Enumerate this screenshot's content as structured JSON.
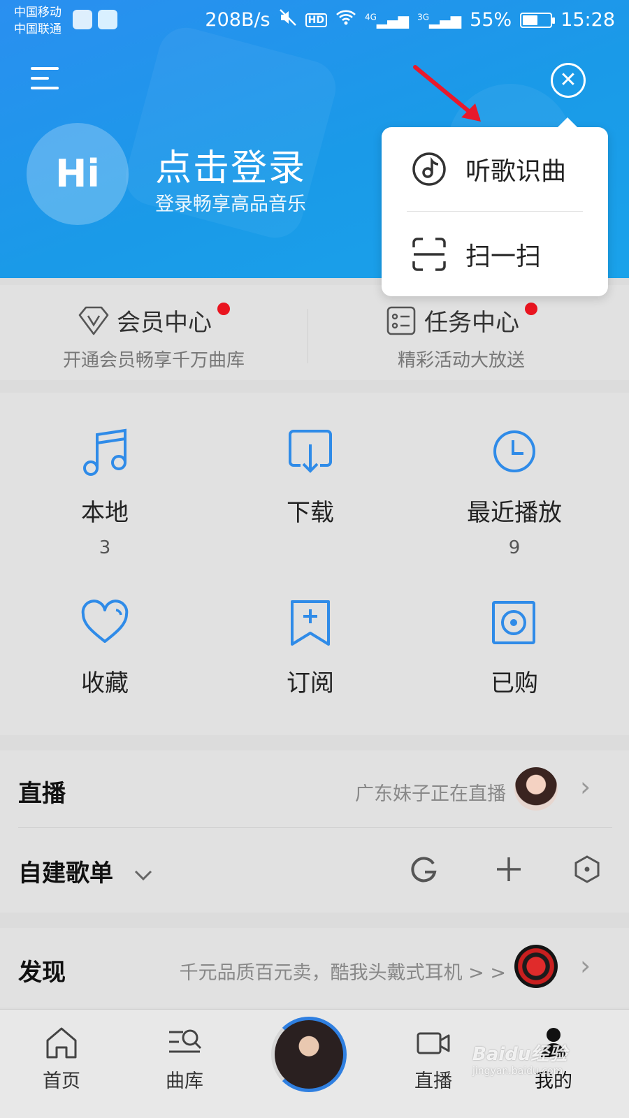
{
  "status_bar": {
    "carrier1": "中国移动",
    "carrier2": "中国联通",
    "speed": "208B/s",
    "hd": "HD",
    "net4g": "4G",
    "net3g": "3G",
    "battery": "55%",
    "battery_level": 0.55,
    "time": "15:28"
  },
  "header": {
    "avatar_text": "Hi",
    "login_title": "点击登录",
    "login_subtitle": "登录畅享高品音乐"
  },
  "popup_menu": {
    "items": [
      {
        "label": "听歌识曲",
        "icon": "music-recognize-icon"
      },
      {
        "label": "扫一扫",
        "icon": "scan-icon"
      }
    ]
  },
  "vip_row": {
    "vip": {
      "title": "会员中心",
      "subtitle": "开通会员畅享千万曲库"
    },
    "task": {
      "title": "任务中心",
      "subtitle": "精彩活动大放送"
    }
  },
  "grid": {
    "items": [
      {
        "label": "本地",
        "count": "3",
        "icon": "music-note-icon"
      },
      {
        "label": "下载",
        "count": "",
        "icon": "download-icon"
      },
      {
        "label": "最近播放",
        "count": "9",
        "icon": "clock-icon"
      },
      {
        "label": "收藏",
        "count": "",
        "icon": "heart-icon"
      },
      {
        "label": "订阅",
        "count": "",
        "icon": "subscribe-icon"
      },
      {
        "label": "已购",
        "count": "",
        "icon": "purchased-icon"
      }
    ]
  },
  "live": {
    "title": "直播",
    "note": "广东妹子正在直播"
  },
  "playlist": {
    "title": "自建歌单"
  },
  "discover": {
    "title": "发现",
    "note": "千元品质百元卖，酷我头戴式耳机 > >"
  },
  "bottom_nav": {
    "home": "首页",
    "library": "曲库",
    "live": "直播",
    "mine": "我的"
  },
  "watermark": {
    "text": "Baidu经验",
    "url": "jingyan.baidu.com"
  },
  "colors": {
    "header_blue": "#1a9ae8",
    "icon_blue": "#2f8be8",
    "red_dot": "#e9141f",
    "arrow_red": "#e8192c"
  }
}
